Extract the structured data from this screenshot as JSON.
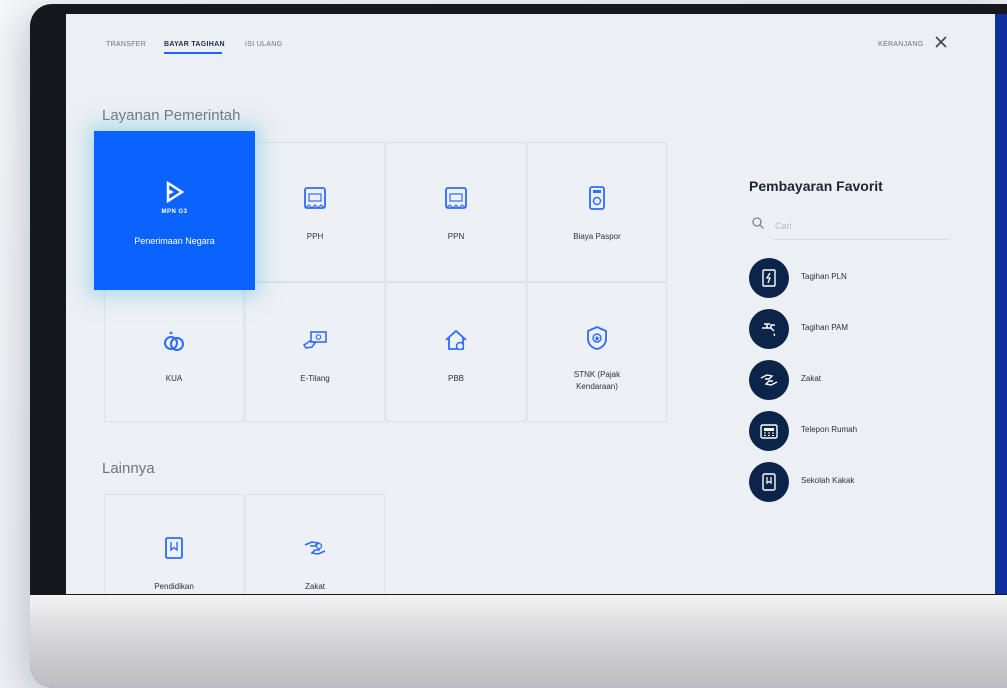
{
  "nav": {
    "tabs": [
      {
        "label": "TRANSFER"
      },
      {
        "label": "BAYAR TAGIHAN"
      },
      {
        "label": "ISI ULANG"
      }
    ],
    "cart_label": "KERANJANG"
  },
  "government": {
    "title": "Layanan Pemerintah",
    "featured": {
      "label": "Penerimaan Negara",
      "logo_text": "MPN G3"
    },
    "items": [
      {
        "label": "PPH",
        "icon": "invoice-icon"
      },
      {
        "label": "PPN",
        "icon": "invoice-icon"
      },
      {
        "label": "Biaya Paspor",
        "icon": "passport-icon"
      },
      {
        "label": "KUA",
        "icon": "rings-icon"
      },
      {
        "label": "E-Tilang",
        "icon": "cash-icon"
      },
      {
        "label": "PBB",
        "icon": "house-icon"
      },
      {
        "label": "STNK (Pajak",
        "label2": "Kendaraan)",
        "icon": "police-badge-icon"
      }
    ]
  },
  "others": {
    "title": "Lainnya",
    "items": [
      {
        "label": "Pendidikan",
        "icon": "book-icon"
      },
      {
        "label": "Zakat",
        "icon": "hands-icon"
      }
    ]
  },
  "favorites": {
    "title": "Pembayaran Favorit",
    "search_placeholder": "Cari",
    "items": [
      {
        "label": "Tagihan PLN",
        "icon": "electricity-icon"
      },
      {
        "label": "Tagihan PAM",
        "icon": "water-tap-icon"
      },
      {
        "label": "Zakat",
        "icon": "hands-icon"
      },
      {
        "label": "Telepon Rumah",
        "icon": "phone-icon"
      },
      {
        "label": "Sekolah Kakak",
        "icon": "school-icon"
      }
    ]
  },
  "colors": {
    "accent": "#0a63ff",
    "icon_blue": "#2f6bff",
    "navy": "#0c2449",
    "screen_bg": "#eceff3"
  }
}
